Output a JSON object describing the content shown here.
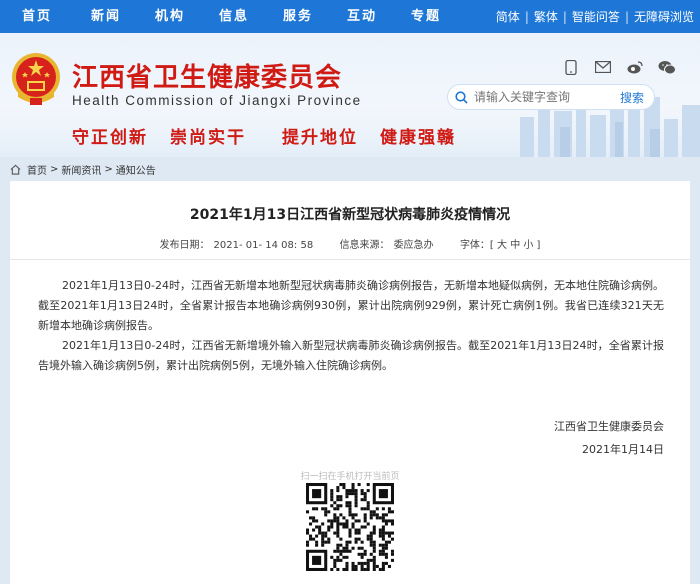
{
  "nav": {
    "items": [
      "首页",
      "新闻",
      "机构",
      "信息",
      "服务",
      "互动",
      "专题"
    ],
    "utils": [
      "简体",
      "繁体",
      "智能问答",
      "无障碍浏览"
    ]
  },
  "header": {
    "title": "江西省卫生健康委员会",
    "subtitle_en": "Health Commission of Jiangxi Province",
    "slogans": [
      "守正创新",
      "崇尚实干",
      "提升地位",
      "健康强赣"
    ],
    "search_placeholder": "请输入关键字查询",
    "search_button": "搜索"
  },
  "breadcrumb": [
    "首页",
    "新闻资讯",
    "通知公告"
  ],
  "article": {
    "title": "2021年1月13日江西省新型冠状病毒肺炎疫情情况",
    "date_label": "发布日期：",
    "date_value": "2021- 01- 14 08: 58",
    "source_label": "信息来源：",
    "source_value": "委应急办",
    "font_label": "字体：[ 大 中 小 ]",
    "paragraphs": [
      "2021年1月13日0-24时，江西省无新增本地新型冠状病毒肺炎确诊病例报告，无新增本地疑似病例，无本地住院确诊病例。截至2021年1月13日24时，全省累计报告本地确诊病例930例，累计出院病例929例，累计死亡病例1例。我省已连续321天无新增本地确诊病例报告。",
      "2021年1月13日0-24时，江西省无新增境外输入新型冠状病毒肺炎确诊病例报告。截至2021年1月13日24时，全省累计报告境外输入确诊病例5例，累计出院病例5例，无境外输入住院确诊病例。"
    ],
    "signature_org": "江西省卫生健康委员会",
    "signature_date": "2021年1月14日",
    "qr_label": "扫一扫在手机打开当前页"
  },
  "colors": {
    "nav_bg": "#1e77d6",
    "title_red": "#d01a14"
  }
}
